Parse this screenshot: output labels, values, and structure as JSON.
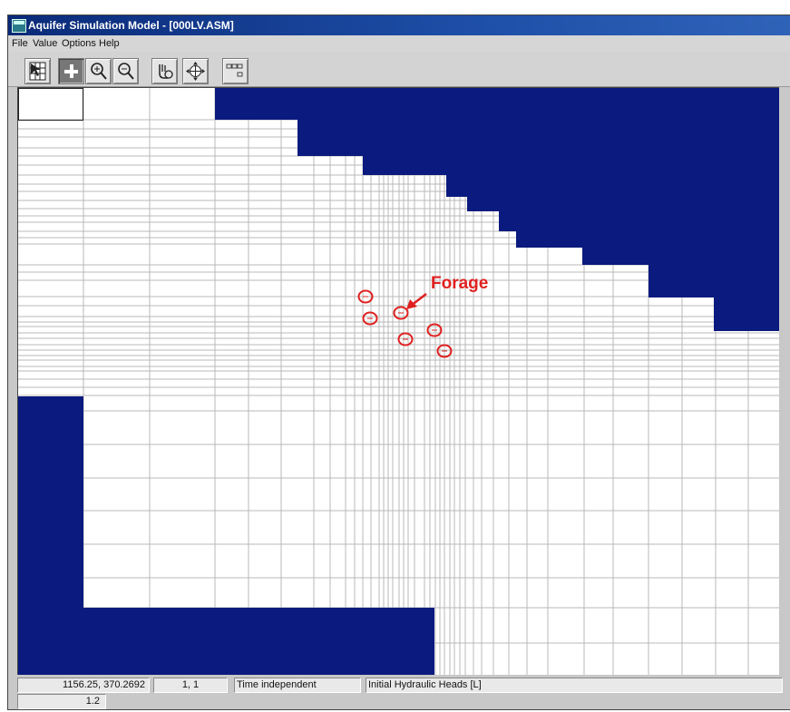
{
  "window": {
    "title": "Aquifer Simulation Model - [000LV.ASM]"
  },
  "menu": {
    "items": [
      "File",
      "Value",
      "Options",
      "Help"
    ]
  },
  "toolbar": {
    "buttons": [
      "select-grid-tool",
      "add-tool",
      "zoom-in",
      "zoom-out",
      "move-tool",
      "pan-tool",
      "value-display"
    ],
    "value_display_icon": "grid-values-icon"
  },
  "annotation": {
    "label": "Forage",
    "color": "#e02020"
  },
  "colors": {
    "inactive": "#0b1a7e",
    "grid_line": "#b8b8b8",
    "active": "#ffffff"
  },
  "status": {
    "coords": "1156.25, 370.2692",
    "cell": "1, 1",
    "time": "Time independent",
    "parameter": "Initial Hydraulic Heads [L]",
    "value": "1.2"
  }
}
